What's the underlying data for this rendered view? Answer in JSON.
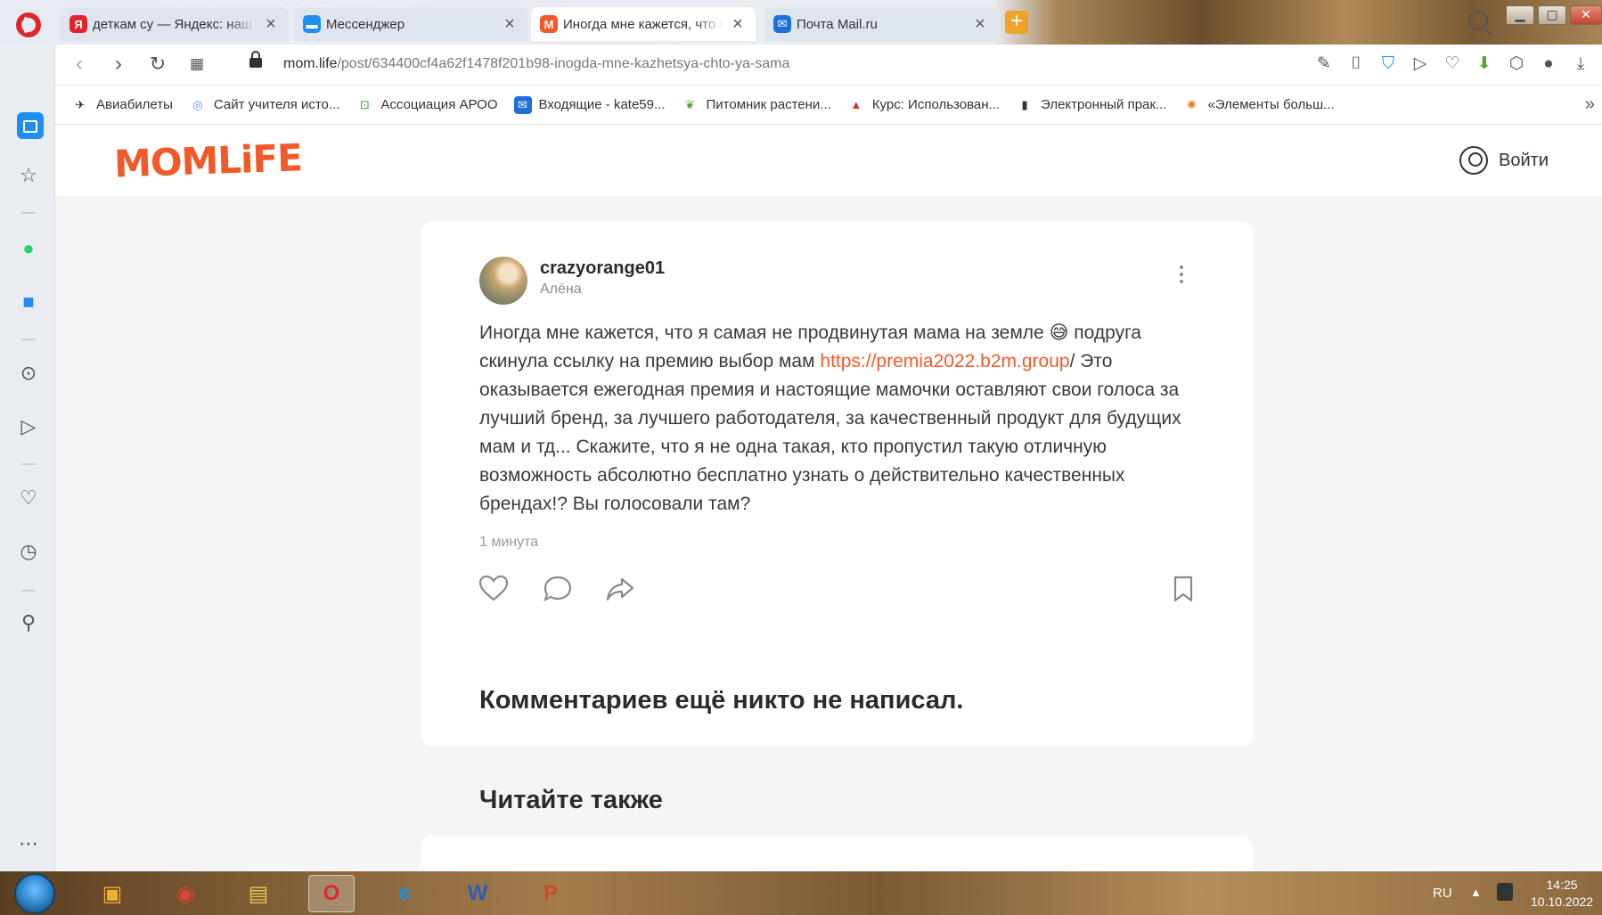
{
  "browser": {
    "tabs": [
      {
        "title": "деткам су — Яндекс: наш",
        "favicon": "yandex-icon",
        "fav_color": "#e0262d",
        "fav_glyph": "Я"
      },
      {
        "title": "Мессенджер",
        "favicon": "messenger-icon",
        "fav_color": "#1f8ef1",
        "fav_glyph": "▬"
      },
      {
        "title": "Иногда мне кажется, что я",
        "favicon": "momlife-icon",
        "fav_color": "#f05a28",
        "fav_glyph": "M"
      },
      {
        "title": "Почта Mail.ru",
        "favicon": "mail-icon",
        "fav_color": "#1e6fd8",
        "fav_glyph": "✉"
      }
    ],
    "active_tab_index": 2,
    "url_host": "mom.life",
    "url_path": "/post/634400cf4a62f1478f201b98-inogda-mne-kazhetsya-chto-ya-sama",
    "bookmarks": [
      {
        "label": "Авиабилеты",
        "icon": "plane-icon",
        "color": "#2b2b2b"
      },
      {
        "label": "Сайт учителя исто...",
        "icon": "globe-icon",
        "color": "#5b8bd6"
      },
      {
        "label": "Ассоциация АРОО",
        "icon": "association-icon",
        "color": "#3a9a45"
      },
      {
        "label": "Входящие - kate59...",
        "icon": "mail-icon",
        "color": "#1e6fd8"
      },
      {
        "label": "Питомник растени...",
        "icon": "plant-icon",
        "color": "#58a22f"
      },
      {
        "label": "Курс: Использован...",
        "icon": "course-icon",
        "color": "#d0302b"
      },
      {
        "label": "Электронный прак...",
        "icon": "document-icon",
        "color": "#333333"
      },
      {
        "label": "«Элементы больш...",
        "icon": "elements-icon",
        "color": "#e97a1d"
      }
    ]
  },
  "site": {
    "logo": "MOMLiFE",
    "login": "Войти"
  },
  "post": {
    "author": "crazyorange01",
    "author_name": "Алёна",
    "text_before": "Иногда мне кажется, что я самая не продвинутая мама на земле 😅 подруга скинула ссылку на премию выбор мам ",
    "link": "https://premia2022.b2m.group",
    "text_after": "/ Это оказывается ежегодная премия и настоящие мамочки оставляют свои голоса за лучший бренд, за лучшего работодателя, за качественный продукт для будущих мам и тд... Скажите, что я не одна такая, кто пропустил такую отличную возможность абсолютно бесплатно узнать о действительно качественных брендах!? Вы голосовали там?",
    "time": "1 минута",
    "no_comments": "Комментариев ещё никто не написал."
  },
  "read_also": "Читайте также",
  "taskbar": {
    "lang": "RU",
    "time": "14:25",
    "date": "10.10.2022"
  },
  "colors": {
    "accent": "#f05a28",
    "opera_red": "#e0262d",
    "sidebar_active": "#1f8ef1"
  }
}
